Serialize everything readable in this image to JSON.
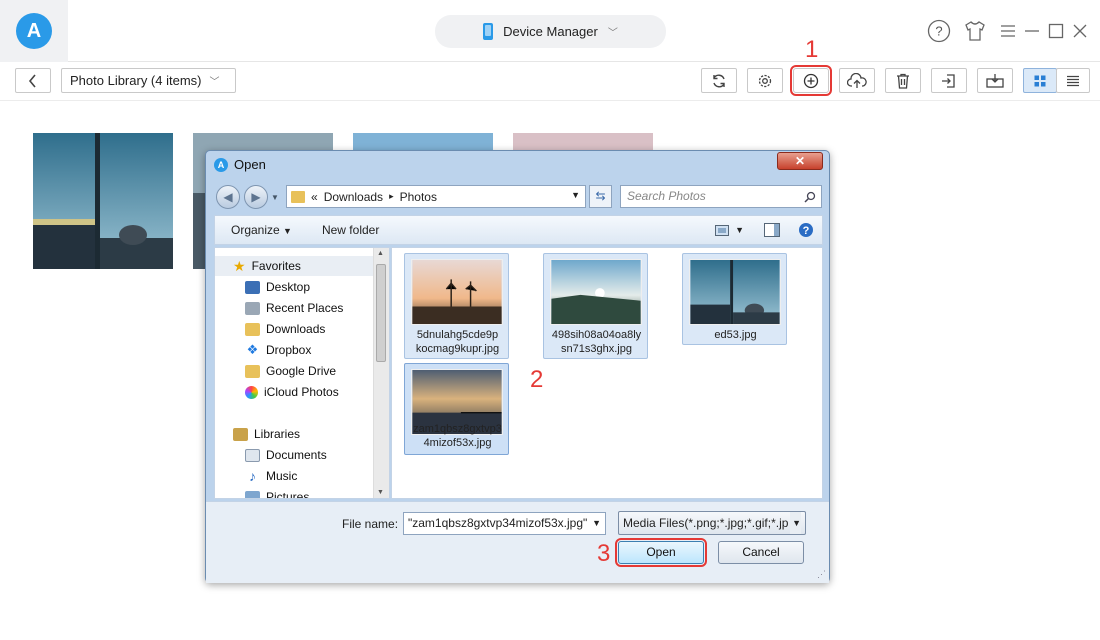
{
  "app": {
    "logo_letter": "A",
    "device_manager_label": "Device Manager",
    "help_glyph": "?",
    "window_controls": [
      "help-icon",
      "skin-icon",
      "menu-icon",
      "minimize-icon",
      "maximize-icon",
      "close-icon"
    ]
  },
  "toolbar": {
    "back_glyph": "<",
    "library_label": "Photo Library (4 items)",
    "library_chevron": "▾",
    "icons": [
      "refresh-icon",
      "settings-icon",
      "add-icon",
      "upload-icon",
      "trash-icon",
      "export-to-device-icon",
      "export-to-computer-icon",
      "grid-view-icon",
      "list-view-icon"
    ],
    "highlighted_button": "add-icon"
  },
  "steps": [
    "1",
    "2",
    "3"
  ],
  "colors": {
    "accent": "#2a9ae8",
    "highlight": "#e53935",
    "dialog_frame": "#bcd3ec",
    "selected_tile": "#dbe8f7"
  },
  "dialog": {
    "title": "Open",
    "close_glyph": "✕",
    "breadcrumb": {
      "prefix": "«",
      "parts": [
        "Downloads",
        "Photos"
      ],
      "separator": "▸"
    },
    "search_placeholder": "Search Photos",
    "organize_label": "Organize",
    "new_folder_label": "New folder",
    "nav": {
      "favorites_label": "Favorites",
      "favorites": [
        "Desktop",
        "Recent Places",
        "Downloads",
        "Dropbox",
        "Google Drive",
        "iCloud Photos"
      ],
      "libraries_label": "Libraries",
      "libraries": [
        "Documents",
        "Music",
        "Pictures"
      ]
    },
    "files": [
      {
        "name_line1": "5dnulahg5cde9p",
        "name_line2": "kocmag9kupr.jpg"
      },
      {
        "name_line1": "498sih08a04oa8ly",
        "name_line2": "sn71s3ghx.jpg"
      },
      {
        "name_line1": "ed53.jpg",
        "name_line2": ""
      },
      {
        "name_line1": "zam1qbsz8gxtvp3",
        "name_line2": "4mizof53x.jpg"
      }
    ],
    "file_name_label": "File name:",
    "file_name_value": "\"zam1qbsz8gxtvp34mizof53x.jpg\"",
    "file_type_value": "Media Files(*.png;*.jpg;*.gif;*.jp",
    "open_label": "Open",
    "cancel_label": "Cancel"
  }
}
